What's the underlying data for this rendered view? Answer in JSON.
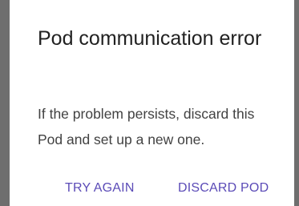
{
  "dialog": {
    "title": "Pod communication error",
    "message": "If the problem persists, discard this Pod and set up a new one.",
    "buttons": {
      "try_again": "TRY AGAIN",
      "discard_pod": "DISCARD POD"
    }
  },
  "colors": {
    "accent": "#5b4bb7",
    "side_edge": "#6e6e6e",
    "title_text": "#212121",
    "body_text": "#424242"
  }
}
